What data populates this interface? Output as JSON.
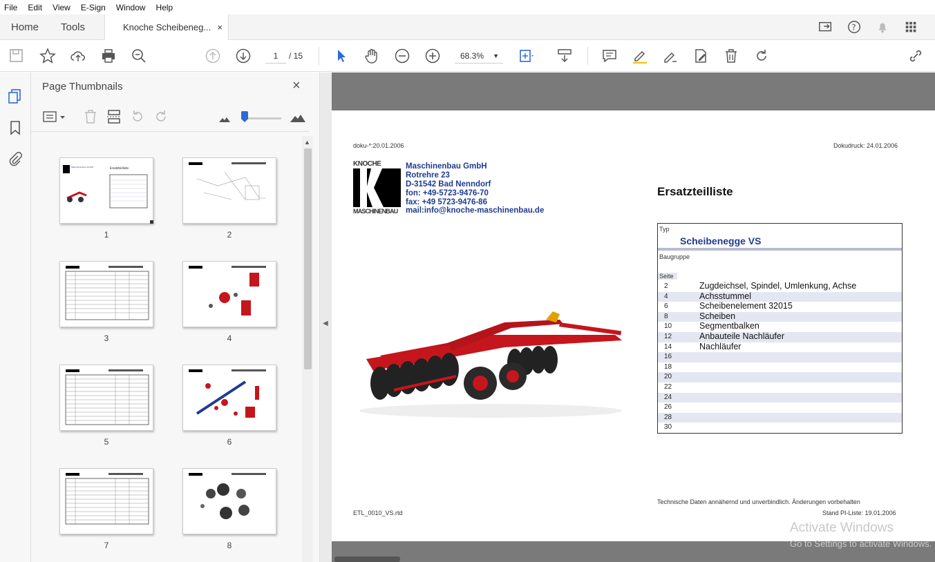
{
  "menu": [
    "File",
    "Edit",
    "View",
    "E-Sign",
    "Window",
    "Help"
  ],
  "tabs": {
    "home": "Home",
    "tools": "Tools",
    "document": "Knoche Scheibeneg...",
    "close": "×"
  },
  "toolbar": {
    "current_page": "1",
    "total_pages": "/ 15",
    "zoom": "68.3%"
  },
  "panel": {
    "title": "Page Thumbnails",
    "close": "×"
  },
  "thumbnails": [
    {
      "label": "1"
    },
    {
      "label": "2"
    },
    {
      "label": "3"
    },
    {
      "label": "4"
    },
    {
      "label": "5"
    },
    {
      "label": "6"
    },
    {
      "label": "7"
    },
    {
      "label": "8"
    }
  ],
  "document": {
    "doku_date": "doku-*:20.01.2006",
    "print_date": "Dokudruck: 24.01.2006",
    "logo_text_top": "KNOCHE",
    "logo_text_bottom": "MASCHINENBAU",
    "company": {
      "name": "Maschinenbau GmbH",
      "street": "Rotrehre 23",
      "city": "D-31542 Bad Nenndorf",
      "phone": "fon: +49-5723-9476-70",
      "fax": "fax: +49 5723-9476-86",
      "mail": "mail:info@knoche-maschinenbau.de"
    },
    "heading": "Ersatzteilliste",
    "typ_label": "Typ",
    "typ_value": "Scheibenegge VS",
    "baugruppe_label": "Baugruppe",
    "seite_label": "Seite",
    "parts": [
      {
        "page": "2",
        "name": "Zugdeichsel, Spindel, Umlenkung, Achse"
      },
      {
        "page": "4",
        "name": "Achsstummel"
      },
      {
        "page": "6",
        "name": "Scheibenelement 32015"
      },
      {
        "page": "8",
        "name": "Scheiben"
      },
      {
        "page": "10",
        "name": "Segmentbalken"
      },
      {
        "page": "12",
        "name": "Anbauteile Nachläufer"
      },
      {
        "page": "14",
        "name": "Nachläufer"
      },
      {
        "page": "16",
        "name": ""
      },
      {
        "page": "18",
        "name": ""
      },
      {
        "page": "20",
        "name": ""
      },
      {
        "page": "22",
        "name": ""
      },
      {
        "page": "24",
        "name": ""
      },
      {
        "page": "26",
        "name": ""
      },
      {
        "page": "28",
        "name": ""
      },
      {
        "page": "30",
        "name": ""
      }
    ],
    "disclaimer": "Technische Daten annähernd und unverbindlich. Änderungen vorbehalten",
    "stand": "Stand PI-Liste: 19.01.2006",
    "file": "ETL_0010_VS.rtd"
  },
  "watermark": {
    "line1": "Activate Windows",
    "line2": "Go to Settings to activate Windows."
  },
  "colors": {
    "accent": "#2d6ad6",
    "brand_blue": "#1f3b8f",
    "machine_red": "#c4161c"
  }
}
